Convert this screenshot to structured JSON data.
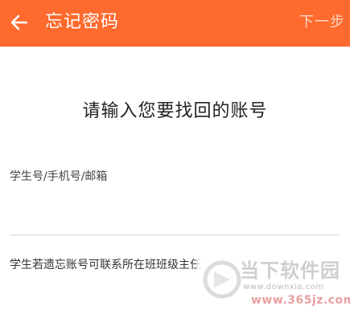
{
  "header": {
    "title": "忘记密码",
    "next_label": "下一步",
    "back_icon": "back-arrow-icon",
    "background": "#ff6a2e"
  },
  "main": {
    "heading": "请输入您要找回的账号",
    "account_field": {
      "placeholder": "学生号/手机号/邮箱",
      "value": ""
    },
    "hint": "学生若遗忘账号可联系所在班班级主任"
  },
  "watermark": {
    "name": "当下软件园",
    "url1": "www.downxia.com",
    "url2": "www.365jz.com"
  }
}
